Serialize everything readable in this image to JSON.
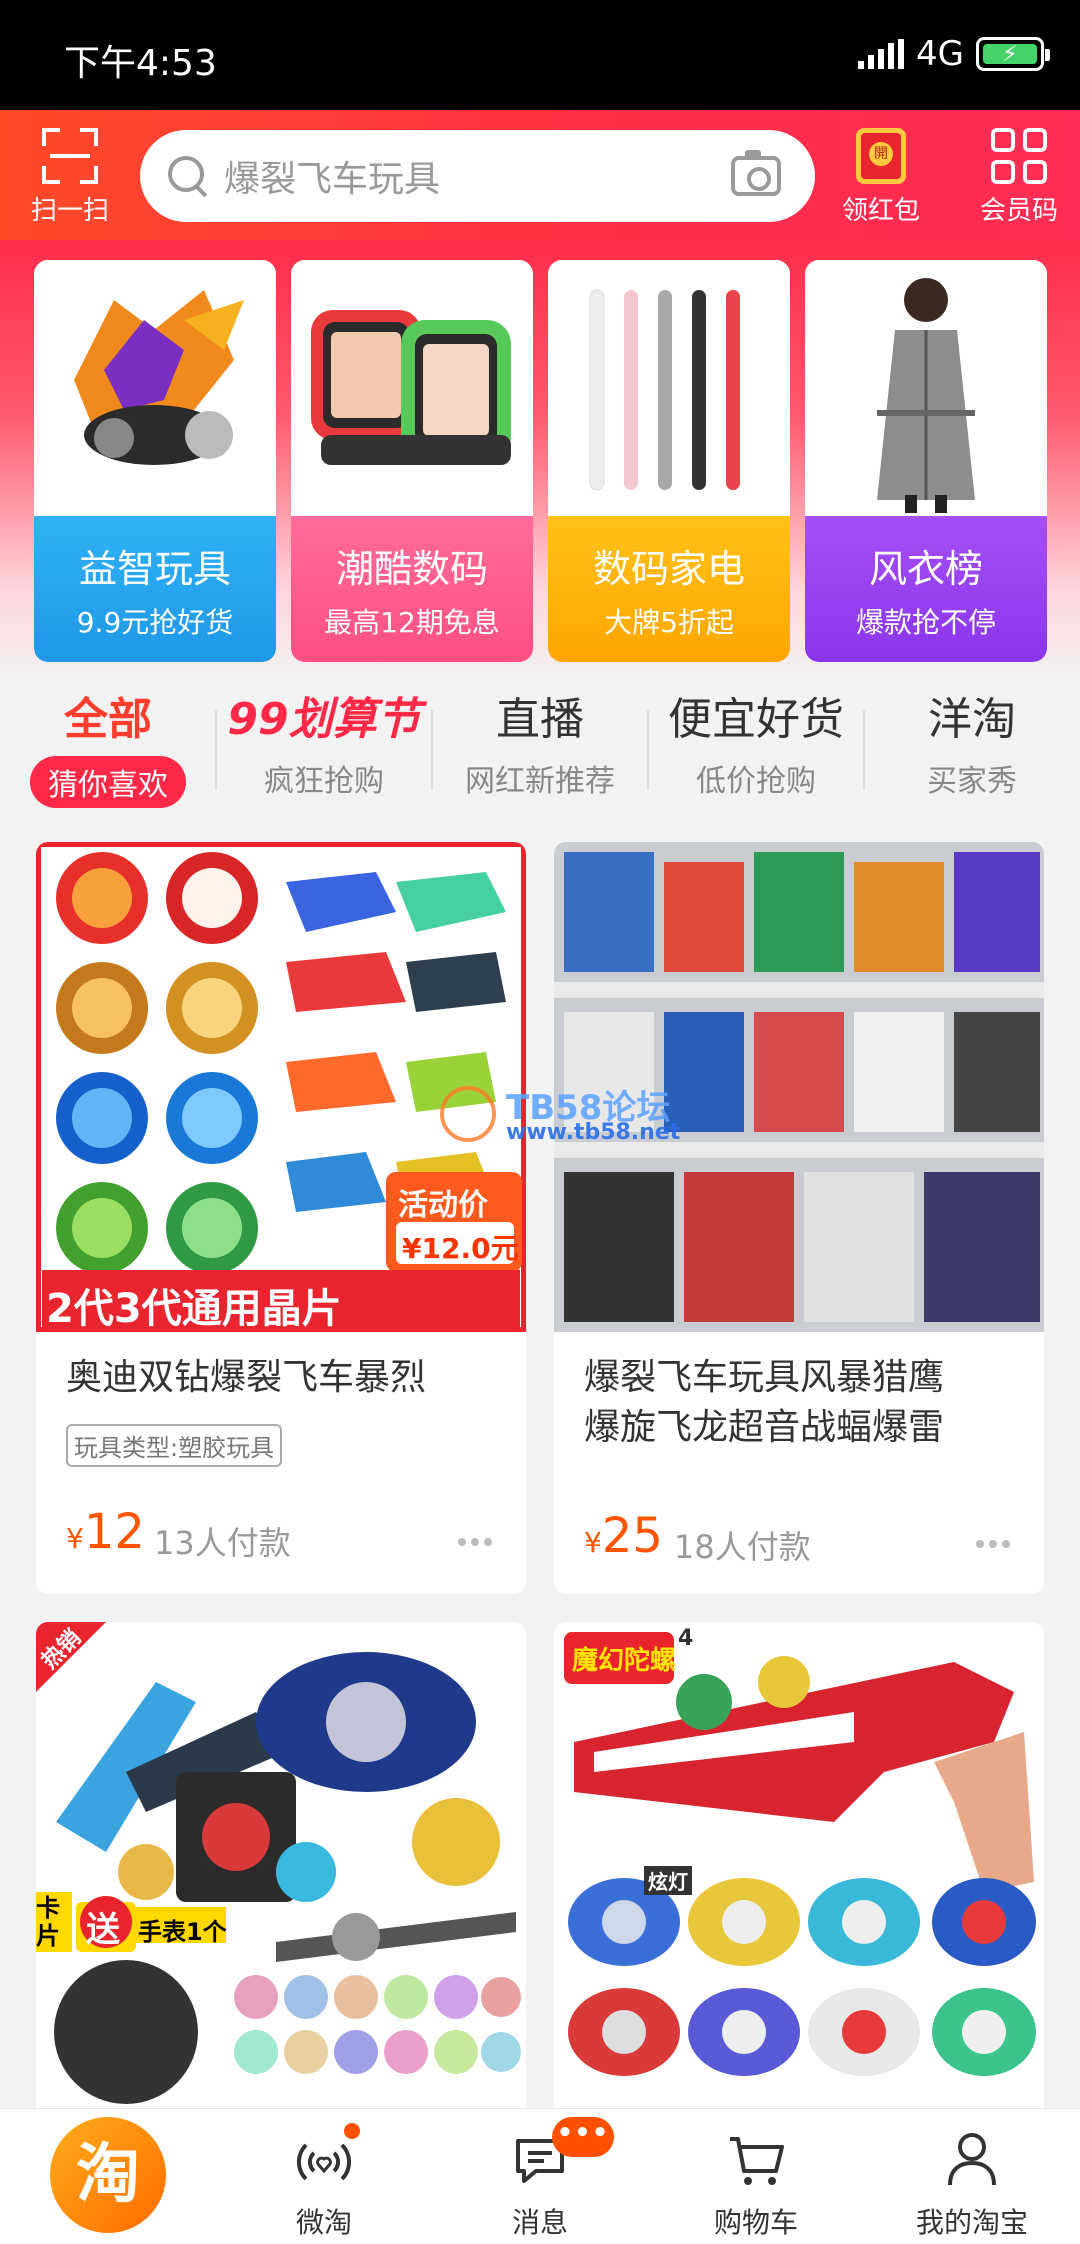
{
  "status_bar": {
    "time": "下午4:53",
    "network": "4G",
    "battery_icon": "battery-charging-icon"
  },
  "header": {
    "scan_label": "扫一扫",
    "search_placeholder": "爆裂飞车玩具",
    "redpack_label": "领红包",
    "member_label": "会员码"
  },
  "categories": [
    {
      "title": "益智玩具",
      "sub": "9.9元抢好货",
      "color": "#2aa8f0"
    },
    {
      "title": "潮酷数码",
      "sub": "最高12期免息",
      "color": "#ff5a8a"
    },
    {
      "title": "数码家电",
      "sub": "大牌5折起",
      "color": "#ffb000"
    },
    {
      "title": "风衣榜",
      "sub": "爆款抢不停",
      "color": "#9c45f5"
    }
  ],
  "tabs": [
    {
      "title": "全部",
      "sub": "猜你喜欢",
      "active": true
    },
    {
      "title": "99划算节",
      "sub": "疯狂抢购"
    },
    {
      "title": "直播",
      "sub": "网红新推荐"
    },
    {
      "title": "便宜好货",
      "sub": "低价抢购"
    },
    {
      "title": "洋淘",
      "sub": "买家秀"
    }
  ],
  "products": [
    {
      "title": "奥迪双钻爆裂飞车暴烈",
      "tag": "玩具类型:塑胶玩具",
      "yen": "¥",
      "price": "12",
      "sold": "13人付款",
      "img_banner": "2代3代通用晶片",
      "img_promo": "活动价",
      "img_promo_price": "¥12.0元"
    },
    {
      "title_line1": "爆裂飞车玩具风暴猎鹰",
      "title_line2": "爆旋飞龙超音战蝠爆雷",
      "yen": "¥",
      "price": "25",
      "sold": "18人付款"
    },
    {
      "img_badge": "热销",
      "img_promo1": "卡片",
      "img_promo2": "送",
      "img_promo3": "手表1个"
    },
    {
      "img_logo": "魔幻陀螺",
      "img_number": "4",
      "img_label": "炫灯"
    }
  ],
  "watermark": {
    "title": "TB58论坛",
    "url": "www.tb58.net"
  },
  "bottom_nav": [
    {
      "label": "淘",
      "icon": "taobao-home-icon"
    },
    {
      "label": "微淘",
      "icon": "weitao-icon"
    },
    {
      "label": "消息",
      "icon": "message-icon",
      "badge": "•••"
    },
    {
      "label": "购物车",
      "icon": "cart-icon"
    },
    {
      "label": "我的淘宝",
      "icon": "profile-icon"
    }
  ]
}
